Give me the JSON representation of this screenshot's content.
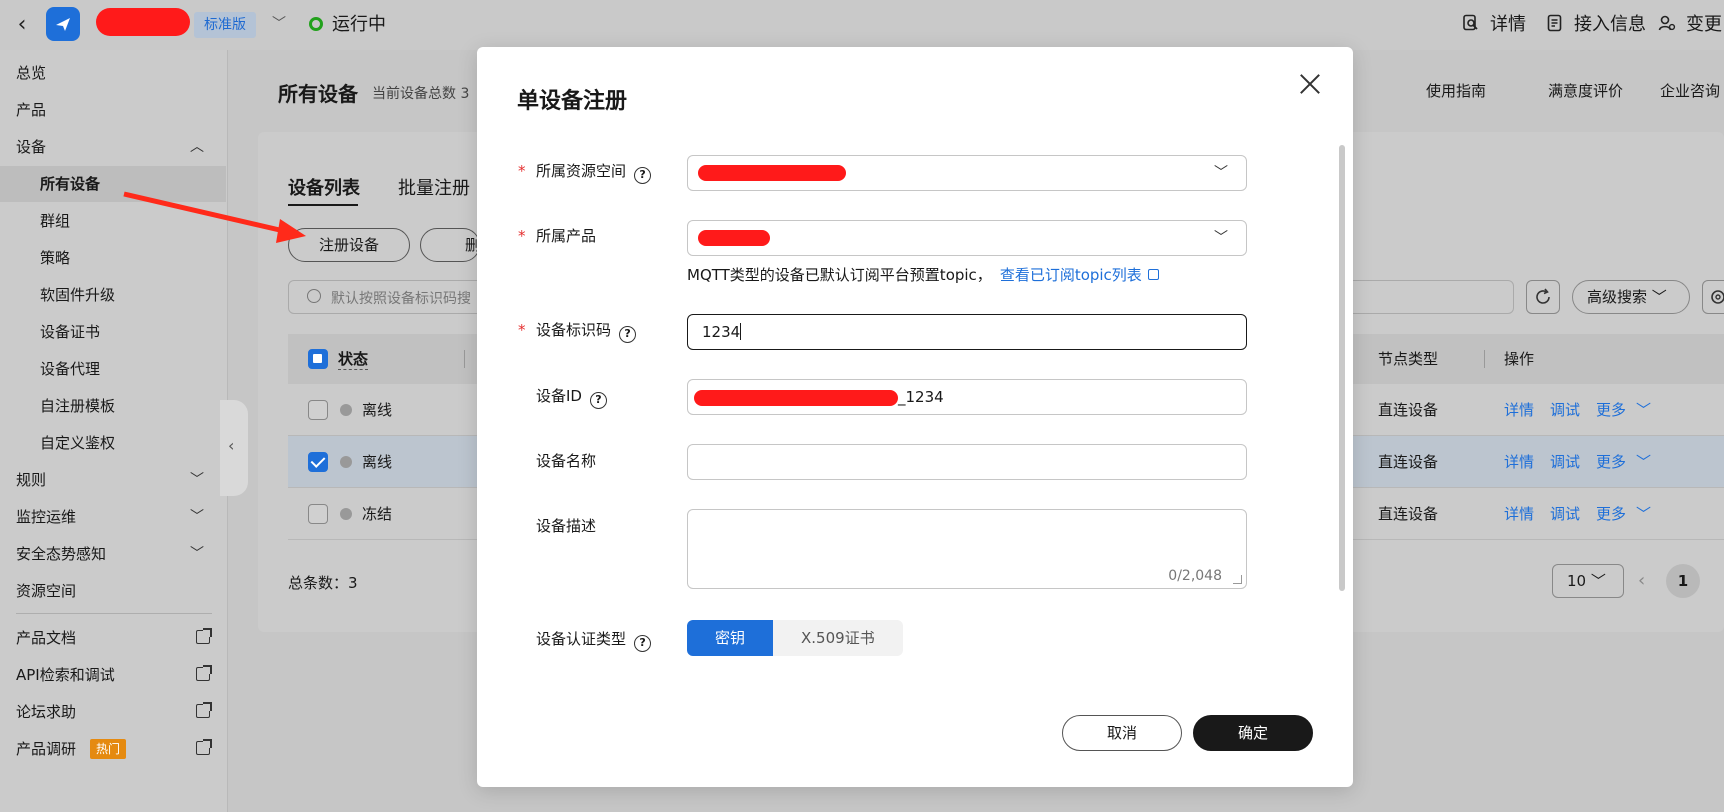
{
  "topbar": {
    "edition_badge": "标准版",
    "status": "运行中",
    "actions": [
      {
        "label": "详情",
        "icon": "search-doc-icon"
      },
      {
        "label": "接入信息",
        "icon": "doc-icon"
      },
      {
        "label": "变更",
        "icon": "user-settings-icon"
      }
    ]
  },
  "sidebar": {
    "items": [
      {
        "label": "总览"
      },
      {
        "label": "产品"
      },
      {
        "label": "设备"
      },
      {
        "label": "所有设备"
      },
      {
        "label": "群组"
      },
      {
        "label": "策略"
      },
      {
        "label": "软固件升级"
      },
      {
        "label": "设备证书"
      },
      {
        "label": "设备代理"
      },
      {
        "label": "自注册模板"
      },
      {
        "label": "自定义鉴权"
      },
      {
        "label": "规则"
      },
      {
        "label": "监控运维"
      },
      {
        "label": "安全态势感知"
      },
      {
        "label": "资源空间"
      },
      {
        "label": "产品文档"
      },
      {
        "label": "API检索和调试"
      },
      {
        "label": "论坛求助"
      },
      {
        "label": "产品调研"
      }
    ],
    "hot_badge": "热门"
  },
  "content": {
    "title": "所有设备",
    "subtitle": "当前设备总数 3",
    "tabs": [
      "设备列表",
      "批量注册"
    ],
    "register_button": "注册设备",
    "delete_button_partial": "删",
    "search_placeholder": "默认按照设备标识码搜",
    "advanced_search": "高级搜索",
    "right_links": [
      {
        "label": "使用指南"
      },
      {
        "label": "满意度评价"
      },
      {
        "label": "企业咨询"
      }
    ],
    "table": {
      "headers": {
        "status": "状态",
        "node_type": "节点类型",
        "actions": "操作"
      },
      "rows": [
        {
          "status": "离线",
          "node_type": "直连设备",
          "checked": false
        },
        {
          "status": "离线",
          "node_type": "直连设备",
          "checked": true
        },
        {
          "status": "冻结",
          "node_type": "直连设备",
          "checked": false
        }
      ],
      "row_actions": [
        "详情",
        "调试",
        "更多"
      ]
    },
    "total": "总条数：3",
    "page_size": "10",
    "current_page": "1"
  },
  "modal": {
    "title": "单设备注册",
    "fields": {
      "resource_space": {
        "label": "所属资源空间",
        "required": true
      },
      "product": {
        "label": "所属产品",
        "required": true
      },
      "hint_text": "MQTT类型的设备已默认订阅平台预置topic，",
      "hint_link": "查看已订阅topic列表",
      "device_code": {
        "label": "设备标识码",
        "required": true,
        "value": "1234"
      },
      "device_id": {
        "label": "设备ID",
        "value_suffix": "_1234"
      },
      "device_name": {
        "label": "设备名称",
        "value": ""
      },
      "device_desc": {
        "label": "设备描述",
        "counter": "0/2,048"
      },
      "auth_type": {
        "label": "设备认证类型",
        "options": [
          "密钥",
          "X.509证书"
        ],
        "selected": "密钥"
      }
    },
    "cancel": "取消",
    "confirm": "确定"
  }
}
